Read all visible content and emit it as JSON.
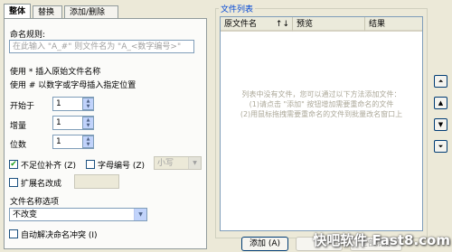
{
  "tabs": [
    {
      "label": "整体"
    },
    {
      "label": "替换"
    },
    {
      "label": "添加/删除"
    }
  ],
  "naming_rule": {
    "label": "命名规则:",
    "placeholder": "在此输入 \"A_#\" 则文件名为 \"A_<数字编号>\""
  },
  "help": {
    "line1": "使用 * 插入原始文件名称",
    "line2": "使用 # 以数字或字母插入指定位置"
  },
  "start": {
    "label": "开始于",
    "value": "1"
  },
  "increment": {
    "label": "增量",
    "value": "1"
  },
  "digits": {
    "label": "位数",
    "value": "1"
  },
  "pad_zero": {
    "label": "不足位补齐 (Z)",
    "checked": true
  },
  "letter_number": {
    "label": "字母编号 (Z)",
    "checked": false
  },
  "case_select": {
    "value": "小写"
  },
  "extension": {
    "label": "扩展名改成",
    "checked": false,
    "value": ""
  },
  "name_options": {
    "label": "文件名称选项",
    "value": "不改变"
  },
  "auto_resolve": {
    "label": "自动解决命名冲突 (I)",
    "checked": false
  },
  "file_list": {
    "title": "文件列表",
    "columns": {
      "original": "原文件名",
      "sort_arrows": "↑↓",
      "preview": "预览",
      "result": "结果"
    },
    "empty_line1": "列表中没有文件，您可以通过以下方法添加文件：",
    "empty_line2": "(1)请点击 \"添加\" 按钮增加需要重命名的文件",
    "empty_line3": "(2)用鼠标拖拽需要重命名的文件到批量改名窗口上"
  },
  "side_buttons": [
    {
      "icon": "move-top-icon",
      "glyph": "⏶"
    },
    {
      "icon": "move-up-icon",
      "glyph": "▲"
    },
    {
      "icon": "move-down-icon",
      "glyph": "▼"
    },
    {
      "icon": "move-bottom-icon",
      "glyph": "⏷"
    }
  ],
  "buttons": {
    "add": "添加 (A)",
    "remove": "",
    "clear_all": "全部清除"
  },
  "watermark": "快吧软件 Fast8.com",
  "colors": {
    "accent": "#0046d5",
    "background": "#ece9d8",
    "check": "#21a121"
  }
}
